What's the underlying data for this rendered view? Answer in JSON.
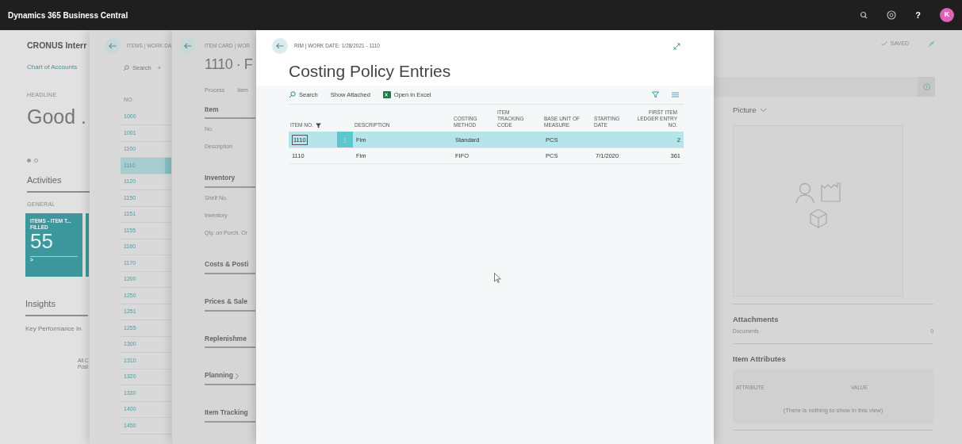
{
  "app_bar": {
    "title": "Dynamics 365 Business Central",
    "help": "?",
    "avatar": "K"
  },
  "home": {
    "company": "CRONUS Interr",
    "link": "Chart of Accounts",
    "headline_label": "HEADLINE",
    "headline": "Good .",
    "pager": [
      {
        "selected": true
      },
      {
        "selected": false
      }
    ],
    "activities": "Activities",
    "group": "GENERAL",
    "tile": {
      "title": "ITEMS - ITEM T...",
      "subtitle": "FILLED",
      "value": "55",
      "more": ">"
    },
    "insights": "Insights",
    "kpi": "Key Performance In",
    "note": [
      "All C",
      "Post"
    ]
  },
  "items_list": {
    "breadcrumb": "ITEMS | WORK DA",
    "search": "Search",
    "add": "+",
    "column": "NO.",
    "rows": [
      {
        "no": "1000",
        "selected": false
      },
      {
        "no": "1001",
        "selected": false
      },
      {
        "no": "1100",
        "selected": false
      },
      {
        "no": "1110",
        "selected": true
      },
      {
        "no": "1120",
        "selected": false
      },
      {
        "no": "1150",
        "selected": false
      },
      {
        "no": "1151",
        "selected": false
      },
      {
        "no": "1155",
        "selected": false
      },
      {
        "no": "1160",
        "selected": false
      },
      {
        "no": "1170",
        "selected": false
      },
      {
        "no": "1200",
        "selected": false
      },
      {
        "no": "1250",
        "selected": false
      },
      {
        "no": "1251",
        "selected": false
      },
      {
        "no": "1255",
        "selected": false
      },
      {
        "no": "1300",
        "selected": false
      },
      {
        "no": "1310",
        "selected": false
      },
      {
        "no": "1320",
        "selected": false
      },
      {
        "no": "1330",
        "selected": false
      },
      {
        "no": "1400",
        "selected": false
      },
      {
        "no": "1450",
        "selected": false
      }
    ]
  },
  "item_card": {
    "breadcrumb": "ITEM CARD | WOR",
    "title": "1110 · F",
    "actions": [
      "Process",
      "Item"
    ],
    "sections": [
      {
        "kind": "heading",
        "text": "Item"
      },
      {
        "kind": "field",
        "text": "No."
      },
      {
        "kind": "field",
        "text": "Description"
      },
      {
        "kind": "heading",
        "text": "Inventory"
      },
      {
        "kind": "field",
        "text": "Shelf No."
      },
      {
        "kind": "field",
        "text": "Inventory"
      },
      {
        "kind": "field",
        "text": "Qty. on Purch. Or"
      },
      {
        "kind": "heading",
        "text": "Costs & Posti"
      },
      {
        "kind": "heading",
        "text": "Prices & Sale"
      },
      {
        "kind": "heading",
        "text": "Replenishme"
      },
      {
        "kind": "heading",
        "text": "Planning",
        "chevron": true
      },
      {
        "kind": "heading",
        "text": "Item Tracking"
      }
    ],
    "status": "SAVED",
    "factbox": {
      "picture_title": "Picture",
      "attachments_title": "Attachments",
      "documents_label": "Documents",
      "documents_count": "0",
      "attributes_title": "Item Attributes",
      "attribute_columns": [
        "ATTRIBUTE",
        "VALUE"
      ],
      "empty_text": "(There is nothing to show in this view)"
    }
  },
  "modal": {
    "breadcrumb": "RIM | WORK DATE: 1/28/2021 - 1110",
    "title": "Costing Policy Entries",
    "actions": [
      {
        "kind": "search",
        "label": "Search"
      },
      {
        "kind": "plain",
        "label": "Show Attached"
      },
      {
        "kind": "excel",
        "label": "Open in Excel"
      }
    ],
    "columns": [
      {
        "label": "ITEM NO.",
        "filtered": true
      },
      {
        "label": "DESCRIPTION",
        "filtered": false
      },
      {
        "label": "COSTING METHOD",
        "filtered": false
      },
      {
        "label": "ITEM TRACKING CODE",
        "filtered": false
      },
      {
        "label": "BASE UNIT OF MEASURE",
        "filtered": false
      },
      {
        "label": "STARTING DATE",
        "filtered": false
      },
      {
        "label": "FIRST ITEM LEDGER ENTRY NO.",
        "filtered": false
      }
    ],
    "rows": [
      {
        "selected": true,
        "menu": "⋮",
        "cells": [
          "1110",
          "Fim",
          "Standard",
          null,
          "PCS",
          null,
          "2"
        ]
      },
      {
        "selected": false,
        "cells": [
          "1110",
          "Fim",
          "FIFO",
          null,
          "PCS",
          "7/1/2020",
          "361"
        ]
      }
    ]
  }
}
